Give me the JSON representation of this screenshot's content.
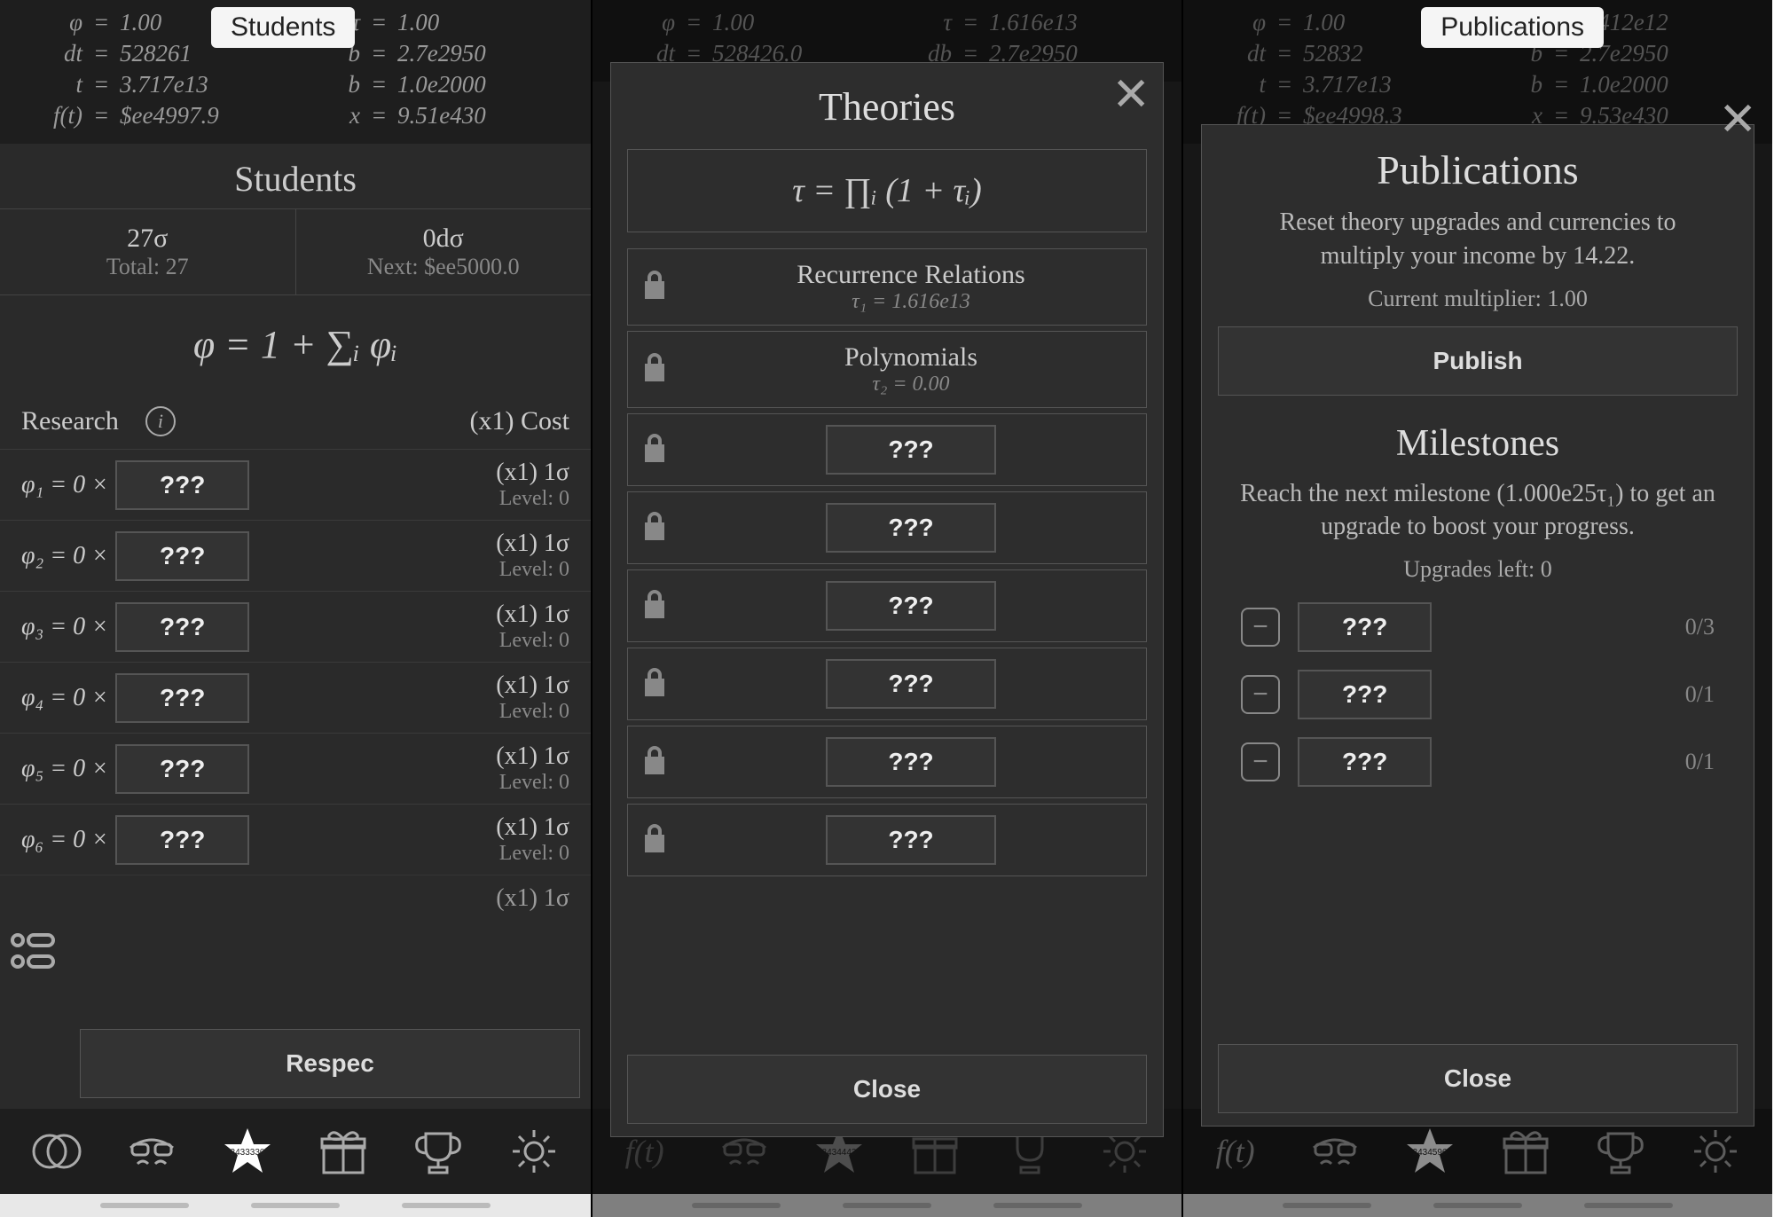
{
  "tags": {
    "left": "Students",
    "right": "Publications"
  },
  "stats_left": {
    "left": [
      {
        "l": "φ",
        "v": "1.00"
      },
      {
        "l": "dt",
        "v": "528261"
      },
      {
        "l": "t",
        "v": "3.717e13"
      },
      {
        "l": "f(t)",
        "v": "$ee4997.9"
      }
    ],
    "right": [
      {
        "l": "τ",
        "v": "1.00"
      },
      {
        "l": "b",
        "v": "2.7e2950"
      },
      {
        "l": "b",
        "v": "1.0e2000"
      },
      {
        "l": "x",
        "v": "9.51e430"
      }
    ]
  },
  "stats_mid": {
    "left": [
      {
        "l": "φ",
        "v": "1.00"
      },
      {
        "l": "dt",
        "v": "528426.0"
      }
    ],
    "right": [
      {
        "l": "τ",
        "v": "1.616e13"
      },
      {
        "l": "db",
        "v": "2.7e2950"
      }
    ]
  },
  "stats_right": {
    "left": [
      {
        "l": "φ",
        "v": "1.00"
      },
      {
        "l": "dt",
        "v": "52832"
      },
      {
        "l": "t",
        "v": "3.717e13"
      },
      {
        "l": "f(t)",
        "v": "$ee4998.3"
      }
    ],
    "right": [
      {
        "l": "τ",
        "v": "4.412e12"
      },
      {
        "l": "b",
        "v": "2.7e2950"
      },
      {
        "l": "b",
        "v": "1.0e2000"
      },
      {
        "l": "x",
        "v": "9.53e430"
      }
    ]
  },
  "students": {
    "title": "Students",
    "sigma": "27σ",
    "sigma_total": "Total: 27",
    "dsigma": "0dσ",
    "next": "Next: $ee5000.0",
    "formula": "φ = 1 + ∑ᵢ φᵢ",
    "research_label": "Research",
    "cost_label": "(x1) Cost",
    "rows": [
      {
        "lhs": "φ₁ = 0 ×",
        "cost": "(x1) 1σ",
        "level": "Level: 0"
      },
      {
        "lhs": "φ₂ = 0 ×",
        "cost": "(x1) 1σ",
        "level": "Level: 0"
      },
      {
        "lhs": "φ₃ = 0 ×",
        "cost": "(x1) 1σ",
        "level": "Level: 0"
      },
      {
        "lhs": "φ₄ = 0 ×",
        "cost": "(x1) 1σ",
        "level": "Level: 0"
      },
      {
        "lhs": "φ₅ = 0 ×",
        "cost": "(x1) 1σ",
        "level": "Level: 0"
      },
      {
        "lhs": "φ₆ = 0 ×",
        "cost": "(x1) 1σ",
        "level": "Level: 0"
      }
    ],
    "extra_cost": "(x1) 1σ",
    "respec": "Respec",
    "unknown": "???"
  },
  "theories": {
    "title": "Theories",
    "formula": "τ = ∏ᵢ (1 + τᵢ)",
    "rows": [
      {
        "name": "Recurrence Relations",
        "sub": "τ₁ = 1.616e13"
      },
      {
        "name": "Polynomials",
        "sub": "τ₂ = 0.00"
      }
    ],
    "locked_count": 6,
    "unknown": "???",
    "close": "Close"
  },
  "publications": {
    "title": "Publications",
    "desc": "Reset theory upgrades and currencies to multiply your income by 14.22.",
    "current": "Current multiplier: 1.00",
    "publish": "Publish",
    "milestones_title": "Milestones",
    "milestones_desc": "Reach the next milestone (1.000e25τ₁) to get an upgrade to boost your progress.",
    "upgrades_left": "Upgrades left: 0",
    "milestones": [
      {
        "count": "0/3"
      },
      {
        "count": "0/1"
      },
      {
        "count": "0/1"
      }
    ],
    "unknown": "???",
    "close": "Close"
  },
  "star_badges": [
    "2433330",
    "2434443",
    "2434596"
  ]
}
